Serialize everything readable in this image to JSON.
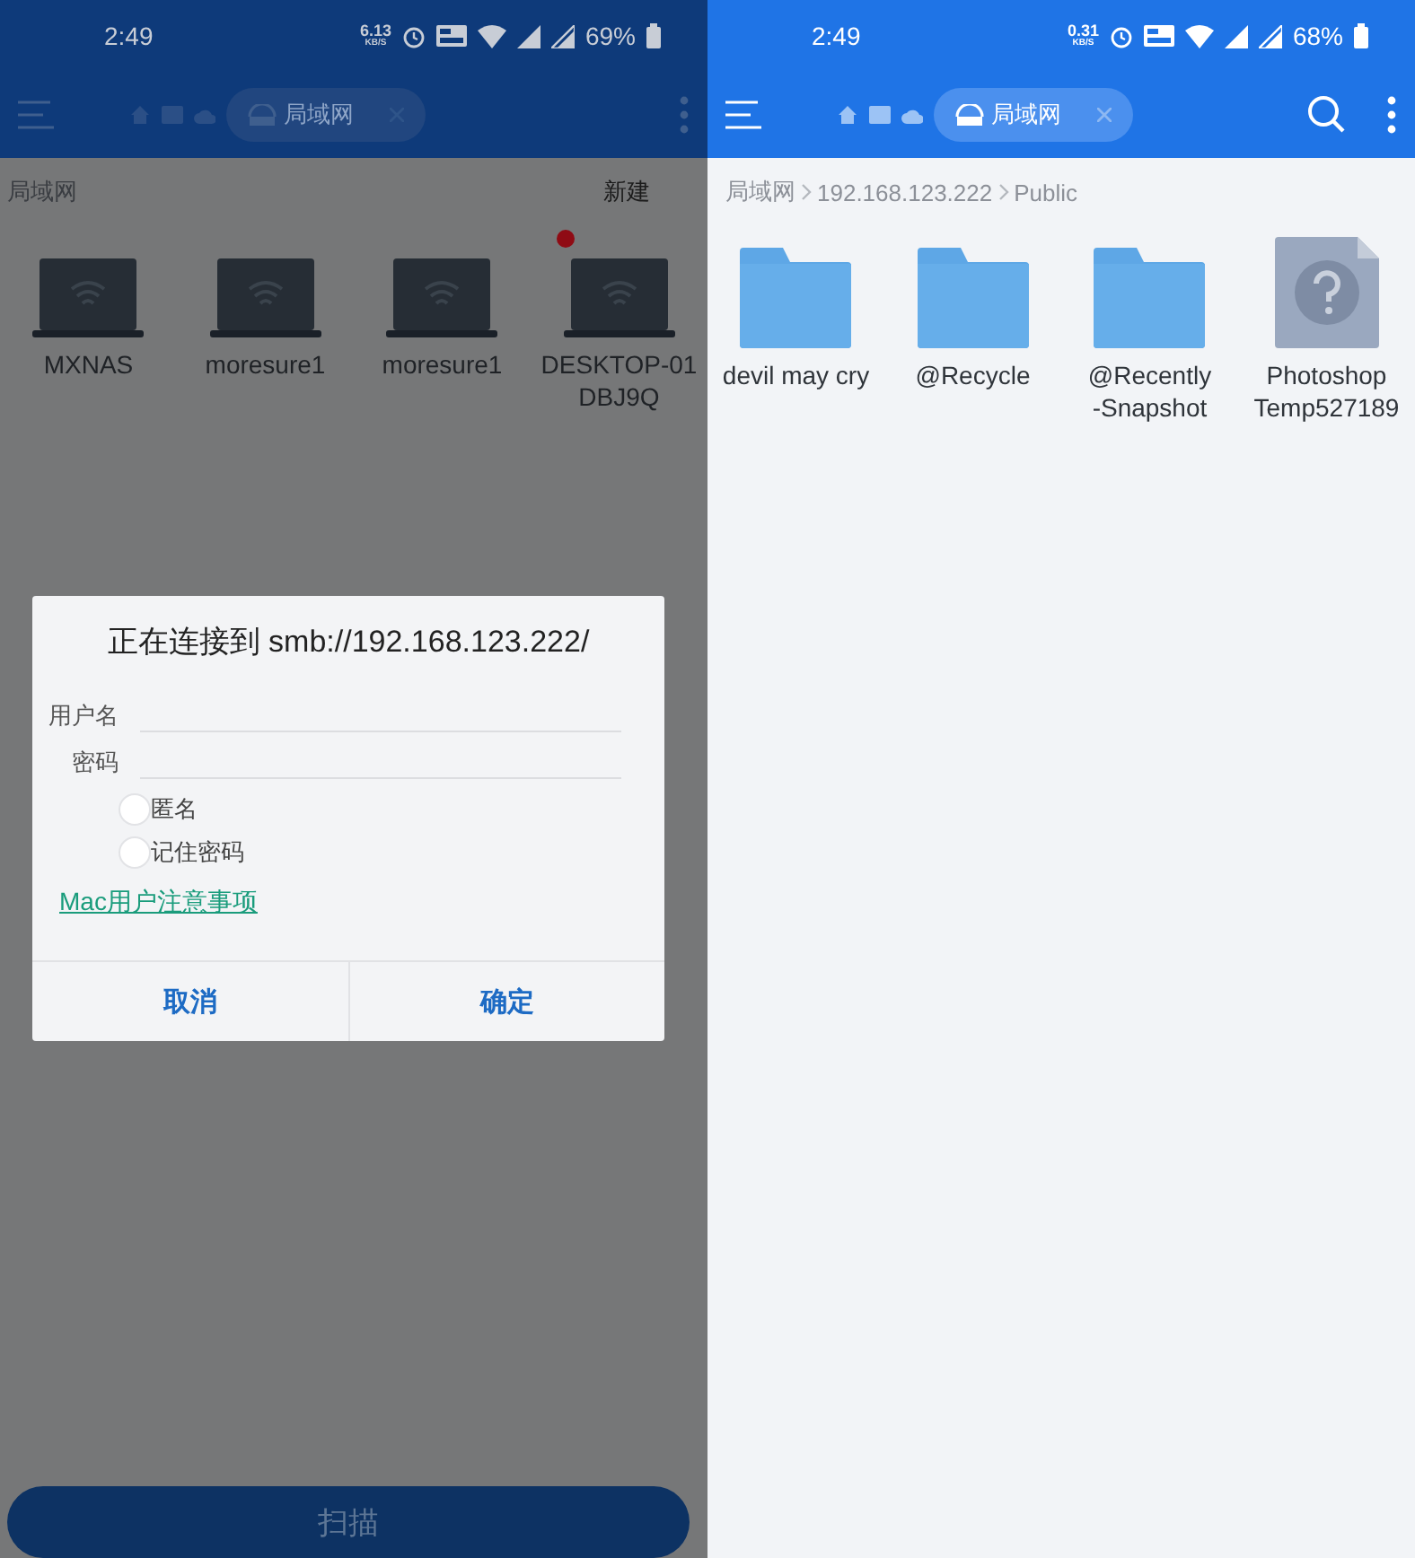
{
  "left_screen": {
    "status_bar": {
      "time": "2:49",
      "net_speed": "6.13",
      "net_unit": "KB/S",
      "battery": "69%"
    },
    "toolbar": {
      "location_tab": "局域网"
    },
    "section_title": "局域网",
    "new_button": "新建",
    "devices": [
      {
        "label_lines": [
          "MXNAS"
        ],
        "badge": false
      },
      {
        "label_lines": [
          "moresure1"
        ],
        "badge": false
      },
      {
        "label_lines": [
          "moresure1"
        ],
        "badge": false
      },
      {
        "label_lines": [
          "DESKTOP-01",
          "DBJ9Q"
        ],
        "badge": true
      }
    ],
    "scan_button": "扫描"
  },
  "dialog": {
    "title": "正在连接到 smb://192.168.123.222/",
    "fields": [
      {
        "label": "用户名"
      },
      {
        "label": "密码"
      }
    ],
    "options": [
      {
        "label": "匿名",
        "checked": false
      },
      {
        "label": "记住密码",
        "checked": false
      }
    ],
    "link": "Mac用户注意事项",
    "buttons": [
      "取消",
      "确定"
    ]
  },
  "right_screen": {
    "status_bar": {
      "time": "2:49",
      "net_speed": "0.31",
      "net_unit": "KB/S",
      "battery": "68%"
    },
    "toolbar": {
      "location_tab": "局域网"
    },
    "breadcrumb": [
      "局域网",
      "192.168.123.222",
      "Public"
    ],
    "files": [
      {
        "kind": "folder",
        "label_lines": [
          "devil may cry"
        ]
      },
      {
        "kind": "folder",
        "label_lines": [
          "@Recycle"
        ]
      },
      {
        "kind": "folder",
        "label_lines": [
          "@Recently",
          "-Snapshot"
        ]
      },
      {
        "kind": "unknown",
        "label_lines": [
          "Photoshop",
          "Temp527189"
        ]
      }
    ]
  }
}
